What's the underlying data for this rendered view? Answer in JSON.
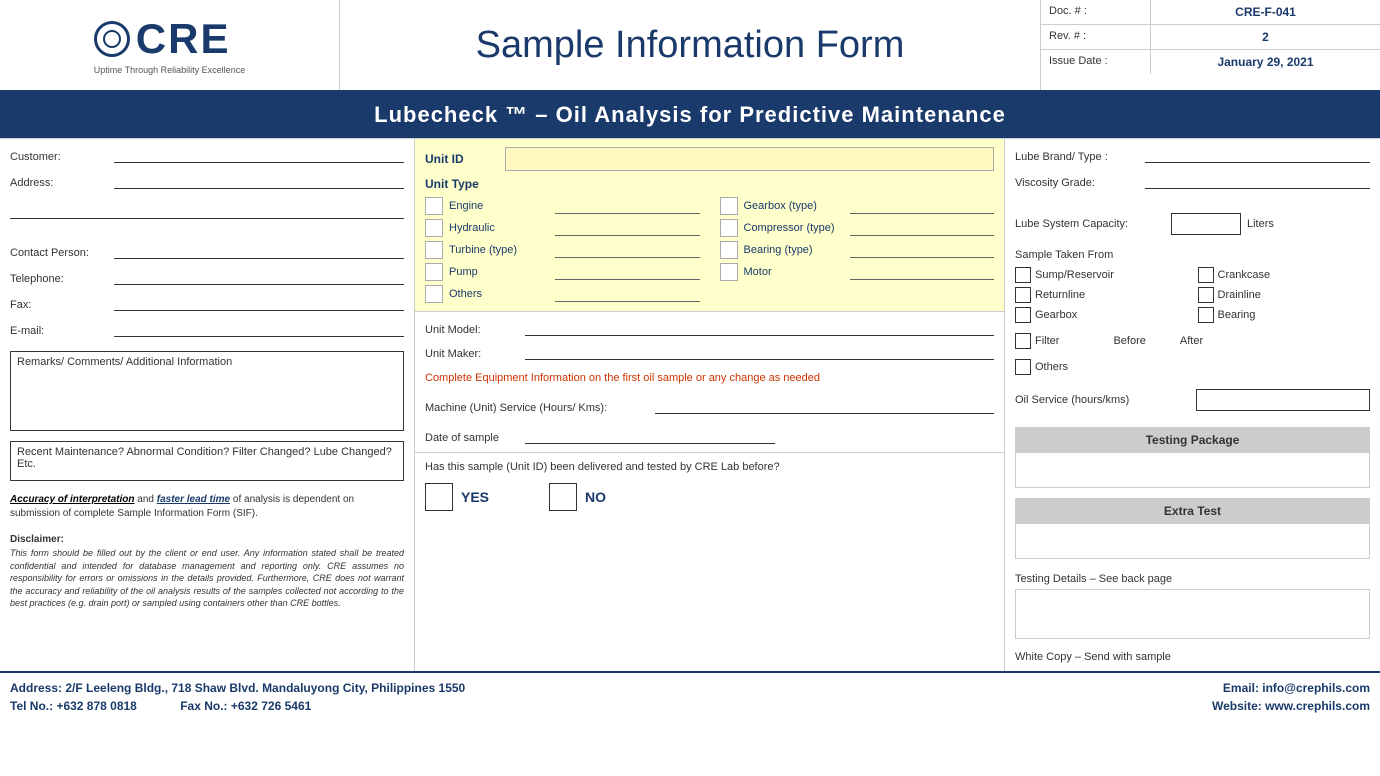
{
  "header": {
    "logo_text": "CRE",
    "logo_tagline": "Uptime Through Reliability Excellence",
    "title": "Sample Information Form",
    "doc_label": "Doc. # :",
    "doc_value": "CRE-F-041",
    "rev_label": "Rev. # :",
    "rev_value": "2",
    "issue_label": "Issue Date :",
    "issue_value": "January 29, 2021"
  },
  "banner": "Lubecheck ™ – Oil Analysis for Predictive Maintenance",
  "left": {
    "customer_label": "Customer:",
    "address_label": "Address:",
    "contact_label": "Contact Person:",
    "telephone_label": "Telephone:",
    "fax_label": "Fax:",
    "email_label": "E-mail:",
    "remarks_title": "Remarks/ Comments/ Additional Information",
    "recent_text": "Recent Maintenance? Abnormal Condition? Filter Changed? Lube Changed? Etc.",
    "accuracy_text1": "Accuracy of interpretation",
    "accuracy_text2": " and ",
    "accuracy_text3": "faster lead time",
    "accuracy_text4": " of analysis is dependent on submission of complete Sample Information Form (SIF).",
    "disclaimer_title": "Disclaimer:",
    "disclaimer_body": "This form should be filled out by the client or end user. Any information stated shall be treated confidential and intended for database management and reporting only. CRE assumes no responsibility for errors or omissions in the details provided. Furthermore, CRE does not warrant the accuracy and reliability of the oil analysis results of the samples collected not according to the best practices (e.g. drain port) or sampled using containers other than CRE bottles."
  },
  "middle": {
    "unit_id_label": "Unit ID",
    "unit_type_label": "Unit Type",
    "unit_types": [
      {
        "name": "Engine",
        "col": 0
      },
      {
        "name": "Gearbox (type)",
        "col": 1
      },
      {
        "name": "Hydraulic",
        "col": 0
      },
      {
        "name": "Compressor (type)",
        "col": 1
      },
      {
        "name": "Turbine (type)",
        "col": 0
      },
      {
        "name": "Bearing (type)",
        "col": 1
      },
      {
        "name": "Pump",
        "col": 0
      },
      {
        "name": "Motor",
        "col": 1
      },
      {
        "name": "Others",
        "col": 0
      }
    ],
    "unit_model_label": "Unit Model:",
    "unit_maker_label": "Unit Maker:",
    "complete_note": "Complete Equipment Information on the first oil sample or any change as needed",
    "service_label": "Machine (Unit) Service (Hours/ Kms):",
    "date_label": "Date of sample",
    "delivered_question": "Has this sample (Unit ID) been delivered and tested by CRE Lab before?",
    "yes_label": "YES",
    "no_label": "NO"
  },
  "right": {
    "lube_brand_label": "Lube Brand/ Type :",
    "viscosity_label": "Viscosity Grade:",
    "lube_system_label": "Lube System Capacity:",
    "lube_system_unit": "Liters",
    "sample_taken_label": "Sample Taken From",
    "sample_items": [
      {
        "label": "Sump/Reservoir",
        "col": 0
      },
      {
        "label": "Crankcase",
        "col": 1
      },
      {
        "label": "Returnline",
        "col": 0
      },
      {
        "label": "Drainline",
        "col": 1
      },
      {
        "label": "Gearbox",
        "col": 0
      },
      {
        "label": "Bearing",
        "col": 1
      }
    ],
    "filter_label": "Filter",
    "before_label": "Before",
    "after_label": "After",
    "others_label": "Others",
    "oil_service_label": "Oil Service (hours/kms)",
    "testing_package_header": "Testing Package",
    "extra_test_header": "Extra Test",
    "testing_details_label": "Testing Details – See back page",
    "white_copy_label": "White Copy – Send with sample"
  },
  "footer": {
    "address_label": "Address: 2/F Leeleng Bldg., 718 Shaw Blvd. Mandaluyong City, Philippines 1550",
    "tel_label": "Tel No.: +632 878 0818",
    "fax_label": "Fax No.: +632 726 5461",
    "email_label": "Email: info@crephils.com",
    "website_label": "Website: www.crephils.com"
  }
}
